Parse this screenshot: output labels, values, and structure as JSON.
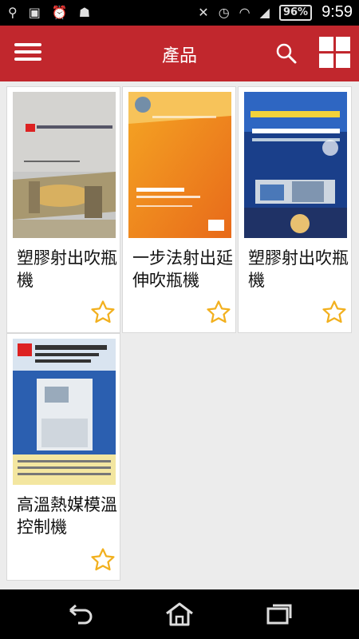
{
  "status_bar": {
    "battery": "96%",
    "time": "9:59"
  },
  "app_bar": {
    "title": "產品"
  },
  "products": [
    {
      "name": "塑膠射出吹瓶機",
      "favorited": false
    },
    {
      "name": "一步法射出延伸吹瓶機",
      "favorited": false
    },
    {
      "name": "塑膠射出吹瓶機",
      "favorited": false
    },
    {
      "name": "高溫熱媒模溫控制機",
      "favorited": false
    }
  ],
  "colors": {
    "app_bar": "#c1272d",
    "star": "#f2b01e"
  }
}
